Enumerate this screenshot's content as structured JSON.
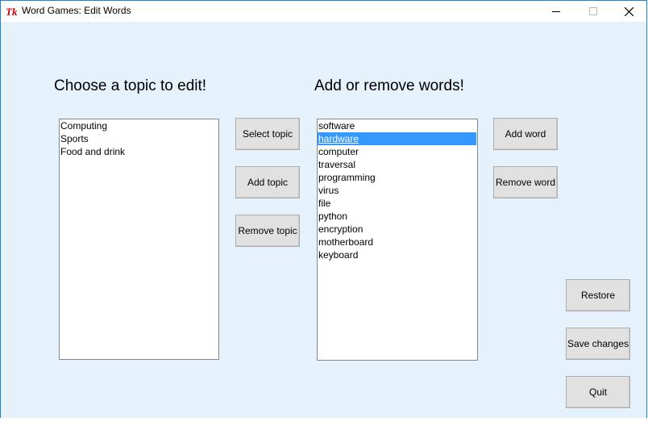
{
  "window": {
    "title": "Word Games: Edit Words"
  },
  "topics_section": {
    "heading": "Choose a topic to edit!",
    "items": [
      "Computing",
      "Sports",
      "Food and drink"
    ],
    "buttons": {
      "select": "Select topic",
      "add": "Add topic",
      "remove": "Remove topic"
    }
  },
  "words_section": {
    "heading": "Add or remove words!",
    "items": [
      "software",
      "hardware",
      "computer",
      "traversal",
      "programming",
      "virus",
      "file",
      "python",
      "encryption",
      "motherboard",
      "keyboard"
    ],
    "selected": "hardware",
    "buttons": {
      "add": "Add word",
      "remove": "Remove word"
    }
  },
  "actions": {
    "restore": "Restore",
    "save": "Save changes",
    "quit": "Quit"
  },
  "colors": {
    "window_bg": "#e5f1fb",
    "selection": "#3399ff",
    "button_bg": "#e1e1e1"
  },
  "icons": {
    "app": "tk-feather-icon",
    "minimize": "minimize-icon",
    "maximize": "maximize-icon",
    "close": "close-icon"
  }
}
